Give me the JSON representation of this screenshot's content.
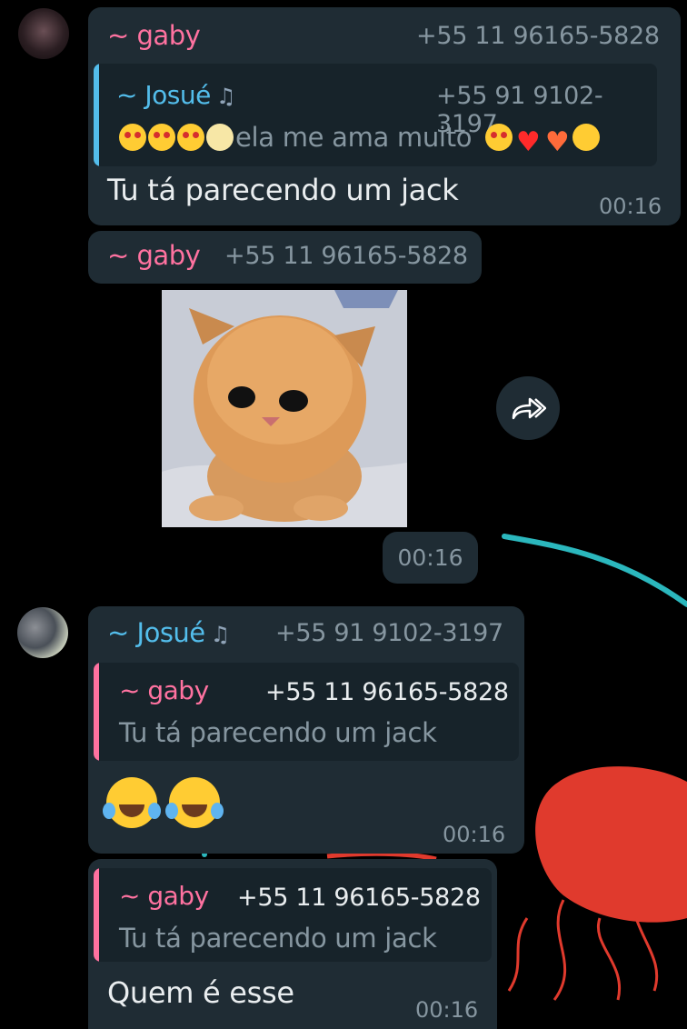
{
  "colors": {
    "background": "#000000",
    "bubble": "#1f2c34",
    "quote_bg": "#17232a",
    "gaby": "#ff72a0",
    "josue": "#53bdeb",
    "meta_text": "#8696a0",
    "doodle_cyan": "#2bb7bd",
    "doodle_red": "#e03a2d"
  },
  "messages": [
    {
      "sender": "~ gaby",
      "phone": "+55 11 96165-5828",
      "quote": {
        "sender": "~ Josué",
        "sender_icon": "music-notes-icon",
        "phone": "+55 91 9102-3197",
        "text": "ela me ama muito",
        "emojis_before": [
          "heart-eyes-emoji",
          "heart-eyes-emoji",
          "heart-eyes-emoji",
          "full-moon-face-emoji"
        ],
        "emojis_after": [
          "heart-eyes-emoji",
          "red-heart-emoji",
          "burning-heart-emoji",
          "relieved-face-emoji"
        ]
      },
      "text": "Tu tá parecendo um jack",
      "time": "00:16"
    },
    {
      "sender": "~ gaby",
      "phone": "+55 11 96165-5828",
      "sticker": "orange-kitten-sticker",
      "time": "00:16"
    },
    {
      "sender": "~ Josué",
      "sender_icon": "music-notes-icon",
      "phone": "+55 91 9102-3197",
      "quote": {
        "sender": "~ gaby",
        "phone": "+55 11 96165-5828",
        "text": "Tu tá parecendo um jack"
      },
      "emojis": [
        "tears-of-joy-emoji",
        "tears-of-joy-emoji"
      ],
      "time": "00:16"
    },
    {
      "quote": {
        "sender": "~ gaby",
        "phone": "+55 11 96165-5828",
        "text": "Tu tá parecendo um jack"
      },
      "text": "Quem é esse",
      "time": "00:16"
    }
  ]
}
